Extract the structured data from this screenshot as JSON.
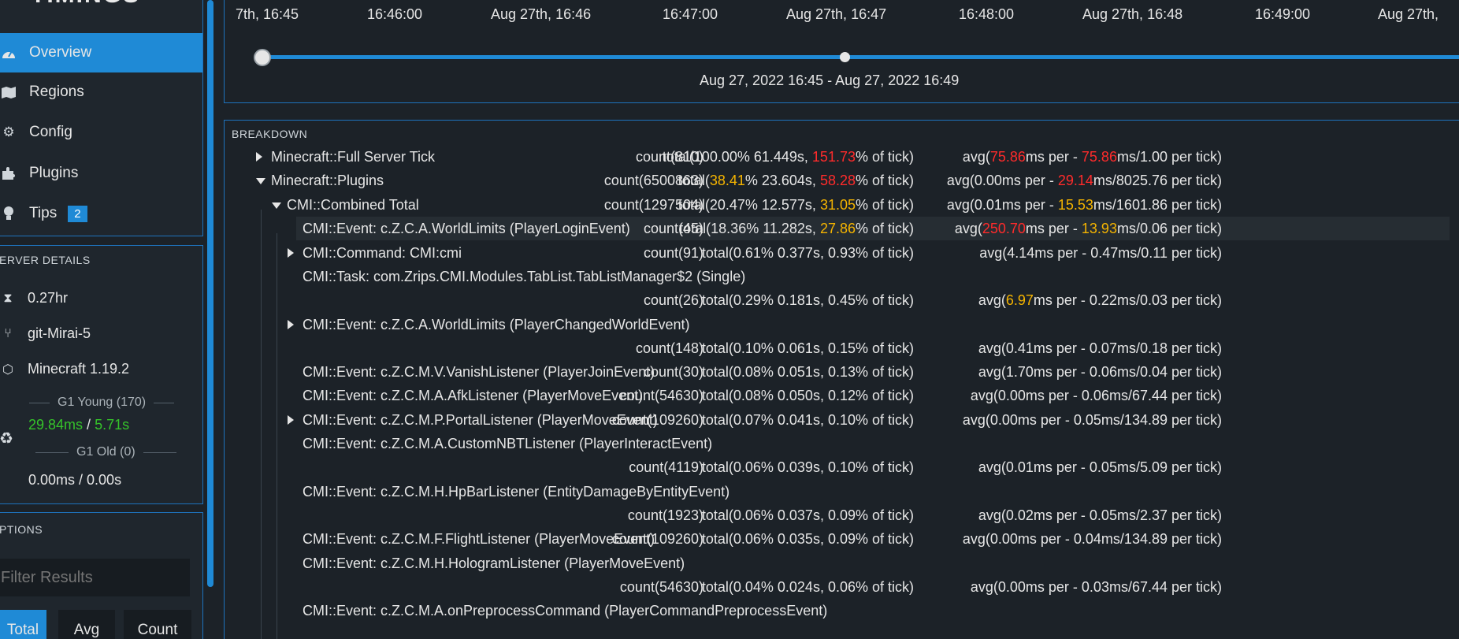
{
  "app": {
    "logo_text": "TIMINGS"
  },
  "nav": [
    {
      "icon": "dashboard-icon",
      "label": "Overview",
      "active": true
    },
    {
      "icon": "map-icon",
      "label": "Regions"
    },
    {
      "icon": "gear-icon",
      "label": "Config"
    },
    {
      "icon": "puzzle-icon",
      "label": "Plugins"
    },
    {
      "icon": "lightbulb-icon",
      "label": "Tips",
      "badge": "2"
    }
  ],
  "server_details": {
    "title": "ERVER DETAILS",
    "uptime": "0.27hr",
    "version": "git-Mirai-5",
    "mc_version": "Minecraft 1.19.2",
    "gc_young_label": "G1 Young (170)",
    "gc_young_ms": "29.84ms",
    "gc_young_sep": " / ",
    "gc_young_s": "5.71s",
    "gc_old_label": "G1 Old (0)",
    "gc_old_value": "0.00ms / 0.00s"
  },
  "options": {
    "title": "PTIONS",
    "filter_placeholder": "Filter Results",
    "sort_buttons": [
      "Total",
      "Avg",
      "Count"
    ]
  },
  "timeline": {
    "ticks": [
      "7th, 16:45",
      "16:46:00",
      "Aug 27th, 16:46",
      "16:47:00",
      "Aug 27th, 16:47",
      "16:48:00",
      "Aug 27th, 16:48",
      "16:49:00",
      "Aug 27th,"
    ],
    "range_label": "Aug 27, 2022 16:45 - Aug 27, 2022 16:49",
    "slider_start_fraction": 0.0,
    "slider_mid_fraction": 0.5
  },
  "breakdown": {
    "title": "BREAKDOWN",
    "rows": [
      {
        "expander": "right",
        "name": "Minecraft::Full Server Tick",
        "count": "count(810)",
        "total": [
          "total(100.00% 61.449s, ",
          {
            "c": "r",
            "t": "151.73"
          },
          "% of tick)"
        ],
        "avg": [
          "avg(",
          {
            "c": "r",
            "t": "75.86"
          },
          "ms per - ",
          {
            "c": "r",
            "t": "75.86"
          },
          "ms/1.00 per tick)"
        ]
      },
      {
        "expander": "down",
        "name": "Minecraft::Plugins",
        "count": "count(6500863)",
        "total": [
          "total(",
          {
            "c": "o",
            "t": "38.41"
          },
          "% 23.604s, ",
          {
            "c": "r",
            "t": "58.28"
          },
          "% of tick)"
        ],
        "avg": [
          "avg(0.00ms per - ",
          {
            "c": "r",
            "t": "29.14"
          },
          "ms/8025.76 per tick)"
        ]
      },
      {
        "expander": "down",
        "name": "CMI::Combined Total",
        "count": "count(1297504)",
        "total": [
          "total(20.47% 12.577s, ",
          {
            "c": "o",
            "t": "31.05"
          },
          "% of tick)"
        ],
        "avg": [
          "avg(0.01ms per - ",
          {
            "c": "o",
            "t": "15.53"
          },
          "ms/1601.86 per tick)"
        ]
      },
      {
        "expander": "none",
        "name": "CMI::Event: c.Z.C.A.WorldLimits (PlayerLoginEvent)",
        "highlight": true,
        "count": "count(45)",
        "total": [
          "total(18.36% 11.282s, ",
          {
            "c": "o",
            "t": "27.86"
          },
          "% of tick)"
        ],
        "avg": [
          "avg(",
          {
            "c": "r",
            "t": "250.70"
          },
          "ms per - ",
          {
            "c": "o",
            "t": "13.93"
          },
          "ms/0.06 per tick)"
        ]
      },
      {
        "expander": "right",
        "name": "CMI::Command: CMI:cmi",
        "count": "count(91)",
        "total": [
          "total(0.61% 0.377s, 0.93% of tick)"
        ],
        "avg": [
          "avg(4.14ms per - 0.47ms/0.11 per tick)"
        ]
      },
      {
        "expander": "none",
        "name": "CMI::Task: com.Zrips.CMI.Modules.TabList.TabListManager$2 (Single)",
        "wrap": true,
        "count": "count(26)",
        "total": [
          "total(0.29% 0.181s, 0.45% of tick)"
        ],
        "avg": [
          "avg(",
          {
            "c": "o",
            "t": "6.97"
          },
          "ms per - 0.22ms/0.03 per tick)"
        ]
      },
      {
        "expander": "right",
        "name": "CMI::Event: c.Z.C.A.WorldLimits (PlayerChangedWorldEvent)",
        "wrap": true,
        "count": "count(148)",
        "total": [
          "total(0.10% 0.061s, 0.15% of tick)"
        ],
        "avg": [
          "avg(0.41ms per - 0.07ms/0.18 per tick)"
        ]
      },
      {
        "expander": "none",
        "name": "CMI::Event: c.Z.C.M.V.VanishListener (PlayerJoinEvent)",
        "count": "count(30)",
        "total": [
          "total(0.08% 0.051s, 0.13% of tick)"
        ],
        "avg": [
          "avg(1.70ms per - 0.06ms/0.04 per tick)"
        ]
      },
      {
        "expander": "none",
        "name": "CMI::Event: c.Z.C.M.A.AfkListener (PlayerMoveEvent)",
        "count": "count(54630)",
        "total": [
          "total(0.08% 0.050s, 0.12% of tick)"
        ],
        "avg": [
          "avg(0.00ms per - 0.06ms/67.44 per tick)"
        ]
      },
      {
        "expander": "right",
        "name": "CMI::Event: c.Z.C.M.P.PortalListener (PlayerMoveEvent)",
        "count": "count(109260)",
        "total": [
          "total(0.07% 0.041s, 0.10% of tick)"
        ],
        "avg": [
          "avg(0.00ms per - 0.05ms/134.89 per tick)"
        ]
      },
      {
        "expander": "none",
        "name": "CMI::Event: c.Z.C.M.A.CustomNBTListener (PlayerInteractEvent)",
        "wrap": true,
        "count": "count(4119)",
        "total": [
          "total(0.06% 0.039s, 0.10% of tick)"
        ],
        "avg": [
          "avg(0.01ms per - 0.05ms/5.09 per tick)"
        ]
      },
      {
        "expander": "none",
        "name": "CMI::Event: c.Z.C.M.H.HpBarListener (EntityDamageByEntityEvent)",
        "wrap": true,
        "count": "count(1923)",
        "total": [
          "total(0.06% 0.037s, 0.09% of tick)"
        ],
        "avg": [
          "avg(0.02ms per - 0.05ms/2.37 per tick)"
        ]
      },
      {
        "expander": "none",
        "name": "CMI::Event: c.Z.C.M.F.FlightListener (PlayerMoveEvent)",
        "count": "count(109260)",
        "total": [
          "total(0.06% 0.035s, 0.09% of tick)"
        ],
        "avg": [
          "avg(0.00ms per - 0.04ms/134.89 per tick)"
        ]
      },
      {
        "expander": "none",
        "name": "CMI::Event: c.Z.C.M.H.HologramListener (PlayerMoveEvent)",
        "wrap": true,
        "count": "count(54630)",
        "total": [
          "total(0.04% 0.024s, 0.06% of tick)"
        ],
        "avg": [
          "avg(0.00ms per - 0.03ms/67.44 per tick)"
        ]
      },
      {
        "expander": "none",
        "name": "CMI::Event: c.Z.C.M.A.onPreprocessCommand (PlayerCommandPreprocessEvent)",
        "wrap": true,
        "count": "",
        "total": [
          ""
        ],
        "avg": [
          ""
        ]
      }
    ]
  },
  "colors": {
    "accent": "#1f8ad6",
    "bad": "#ff2b2b",
    "warn": "#f5b400",
    "good": "#35c42a"
  }
}
